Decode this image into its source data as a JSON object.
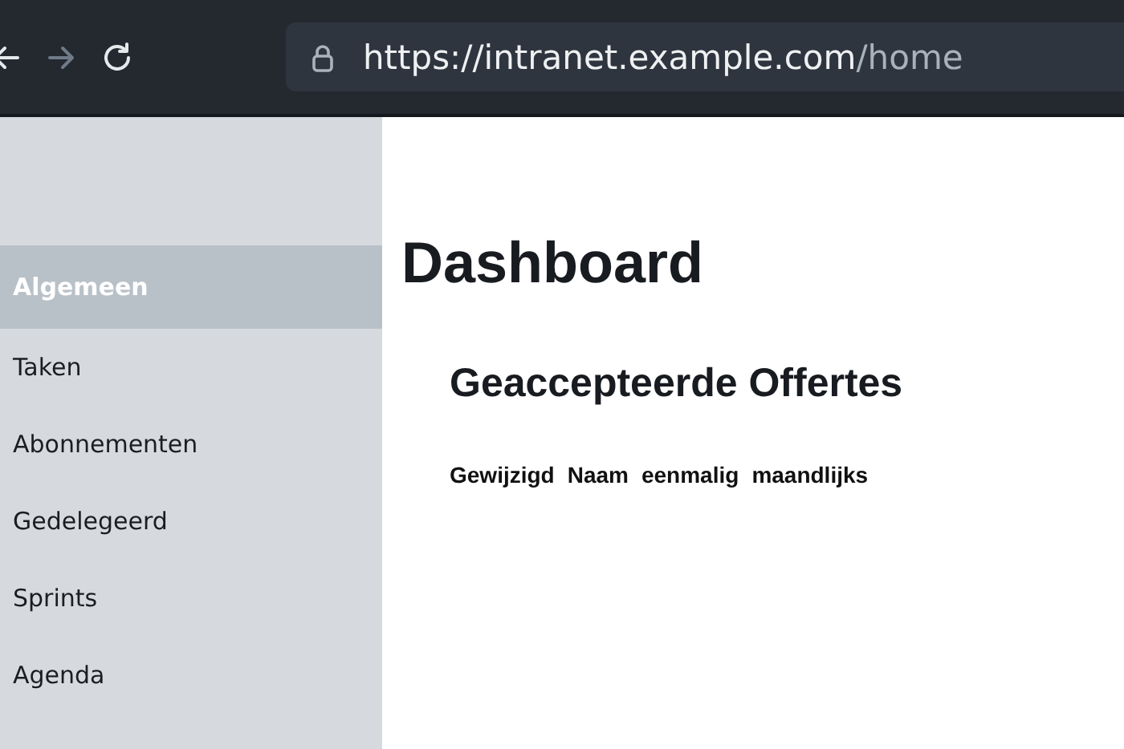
{
  "browser": {
    "nav_buttons": [
      {
        "kind": "back",
        "disabled": false
      },
      {
        "kind": "forward",
        "disabled": true
      },
      {
        "kind": "reload",
        "disabled": false
      }
    ],
    "address": {
      "host": "https://intranet.example.com",
      "path": "/home"
    }
  },
  "sidebar": {
    "items": [
      {
        "label": "Algemeen",
        "selected": true
      },
      {
        "label": "Taken",
        "selected": false
      },
      {
        "label": "Abonnementen",
        "selected": false
      },
      {
        "label": "Gedelegeerd",
        "selected": false
      },
      {
        "label": "Sprints",
        "selected": false
      },
      {
        "label": "Agenda",
        "selected": false
      }
    ]
  },
  "main": {
    "title": "Dashboard",
    "section_title": "Geaccepteerde Offertes",
    "table": {
      "columns": [
        "Gewijzigd",
        "Naam",
        "eenmalig",
        "maandlijks"
      ]
    }
  }
}
